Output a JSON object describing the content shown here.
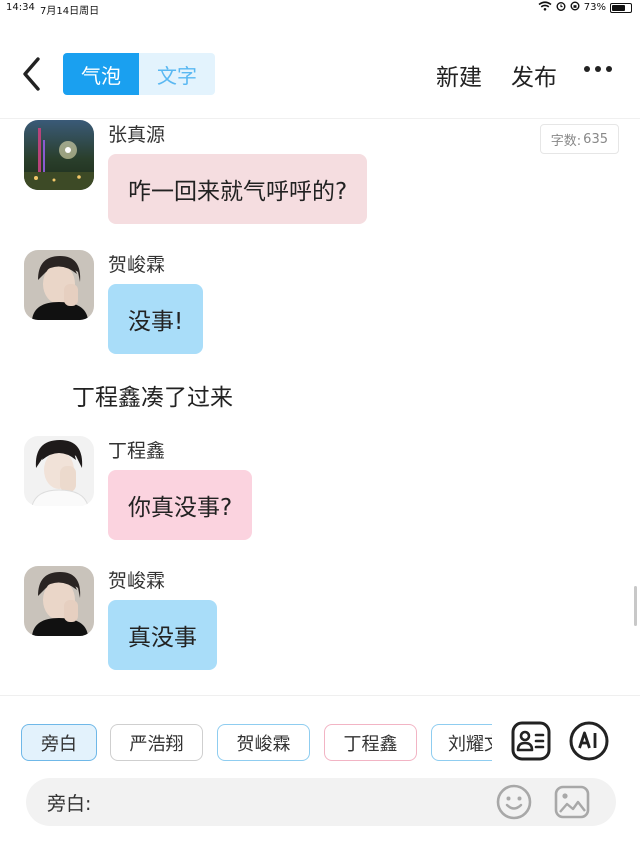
{
  "status_bar": {
    "time": "14:34",
    "date": "7月14日周日",
    "battery": "73%",
    "battery_level": 0.73
  },
  "header": {
    "tabs": [
      {
        "label": "气泡",
        "active": true
      },
      {
        "label": "文字",
        "active": false
      }
    ],
    "new_label": "新建",
    "publish_label": "发布"
  },
  "word_count": {
    "label": "字数:",
    "value": "635"
  },
  "messages": [
    {
      "sender": "张真源",
      "text": "咋一回来就气呼呼的?",
      "bubble_color": "#f5dde0"
    },
    {
      "sender": "贺峻霖",
      "text": "没事!",
      "bubble_color": "#a9ddf9"
    },
    {
      "sender": "丁程鑫",
      "text": "你真没事?",
      "bubble_color": "#fbd3df"
    },
    {
      "sender": "贺峻霖",
      "text": "真没事",
      "bubble_color": "#a9ddf9"
    }
  ],
  "narration": "丁程鑫凑了过来",
  "characters": [
    "旁白",
    "严浩翔",
    "贺峻霖",
    "丁程鑫",
    "刘耀文"
  ],
  "input": {
    "prefix": "旁白:",
    "placeholder": "",
    "value": ""
  },
  "colors": {
    "accent": "#1aa0f0",
    "accent_light": "#e3f3fd",
    "blue_bubble": "#a9ddf9",
    "pink_bubble": "#fbd3df"
  },
  "icons": {
    "back": "chevron-left-icon",
    "more": "more-horizontal-icon",
    "contact": "contact-card-icon",
    "ai": "ai-icon",
    "emoji": "emoji-icon",
    "image": "image-icon"
  }
}
